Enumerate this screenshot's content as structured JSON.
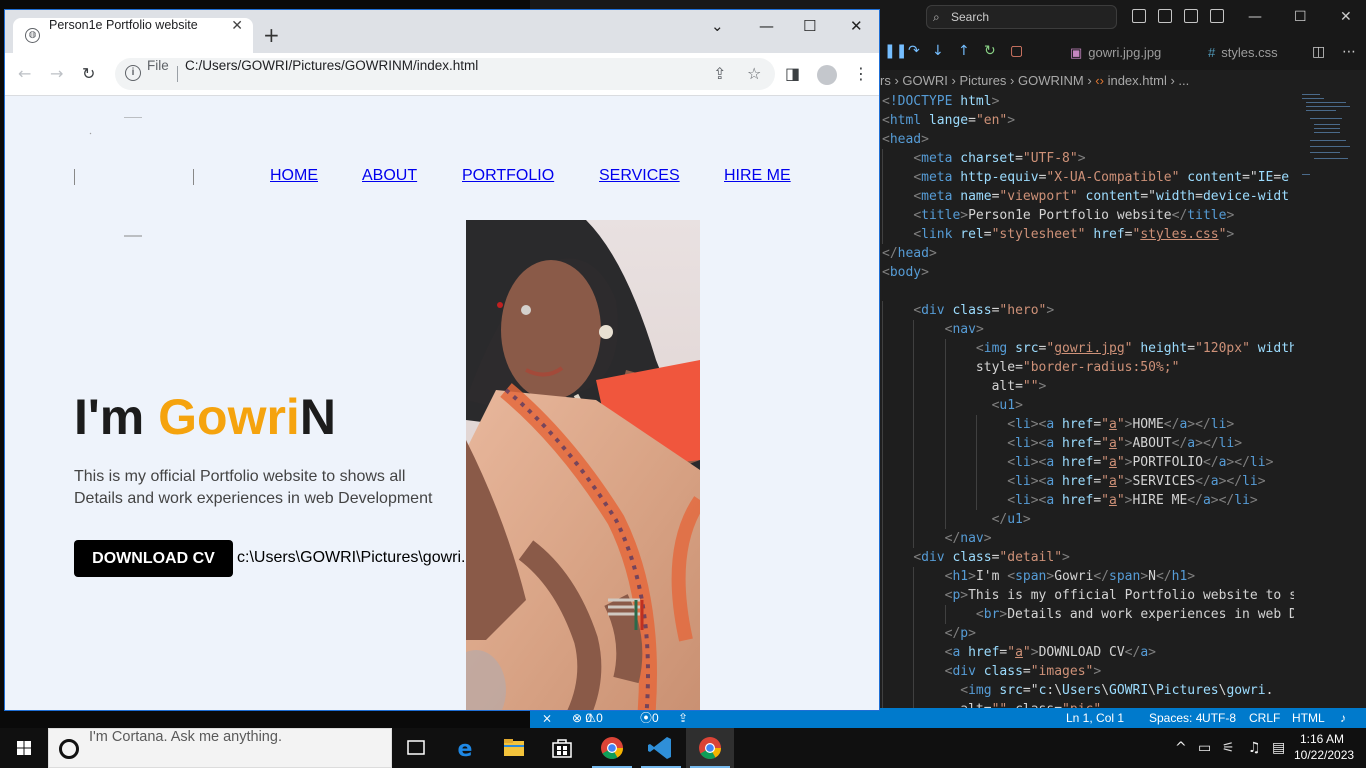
{
  "vscode": {
    "search_placeholder": "Search",
    "search_icon": "search-icon",
    "tabs": [
      {
        "label": "gowri.jpg.jpg",
        "icon": "image-file-icon"
      },
      {
        "label": "styles.css",
        "icon": "css-file-icon"
      }
    ],
    "breadcrumb": [
      "rs",
      "GOWRI",
      "Pictures",
      "GOWRINM",
      "index.html",
      "..."
    ],
    "code_lines": [
      "<!DOCTYPE html>",
      "<html lange=\"en\">",
      "<head>",
      "    <meta charset=\"UTF-8\">",
      "    <meta http-equiv=\"X-UA-Compatible\" content=\"IE=e",
      "    <meta name=\"viewport\" content=\"width=device-widt",
      "    <title>Person1e Portfolio website</title>",
      "    <link rel=\"stylesheet\" href=\"styles.css\">",
      "</head>",
      "<body>",
      "",
      "    <div class=\"hero\">",
      "        <nav>",
      "            <img src=\"gowri.jpg\" height=\"120px\" width",
      "            style=\"border-radius:50%;\"",
      "              alt=\"\">",
      "              <u1>",
      "                <li><a href=\"a\">HOME</a></li>",
      "                <li><a href=\"a\">ABOUT</a></li>",
      "                <li><a href=\"a\">PORTFOLIO</a></li>",
      "                <li><a href=\"a\">SERVICES</a></li>",
      "                <li><a href=\"a\">HIRE ME</a></li>",
      "              </u1>",
      "        </nav>",
      "    <div class=\"detail\">",
      "        <h1>I'm <span>Gowri</span>N</h1>",
      "        <p>This is my official Portfolio website to s",
      "            <br>Details and work experiences in web D",
      "        </p>",
      "        <a href=\"a\">DOWNLOAD CV</a>",
      "        <div class=\"images\">",
      "          <img src=\"c:\\Users\\GOWRI\\Pictures\\gowri.",
      "          alt=\"\" class=\"pic\""
    ],
    "status": {
      "errors": "0",
      "warnings": "0",
      "ports": "0",
      "position": "Ln 1, Col 1",
      "spaces": "Spaces: 4",
      "encoding": "UTF-8",
      "eol": "CRLF",
      "language": "HTML"
    }
  },
  "browser": {
    "tab_title": "Person1e Portfolio website",
    "new_tab": "+",
    "url_scheme_label": "File",
    "url": "C:/Users/GOWRI/Pictures/GOWRINM/index.html",
    "page": {
      "nav_items": [
        "HOME",
        "ABOUT",
        "PORTFOLIO",
        "SERVICES",
        "HIRE ME"
      ],
      "heading_prefix": "I'm ",
      "heading_name": "Gowri",
      "heading_suffix": "N",
      "paragraph": "This is my official Portfolio website to shows all Details and work experiences in web Development",
      "cv_button": "DOWNLOAD CV",
      "broken_image_alt": "c:\\Users\\GOWRI\\Pictures\\gowri.jpg"
    }
  },
  "taskbar": {
    "cortana_placeholder": "I'm Cortana. Ask me anything.",
    "time": "1:16 AM",
    "date": "10/22/2023"
  },
  "colors": {
    "accent_name": "#f5a30e",
    "vscode_status": "#007acc",
    "page_bg": "#eef3fb"
  }
}
